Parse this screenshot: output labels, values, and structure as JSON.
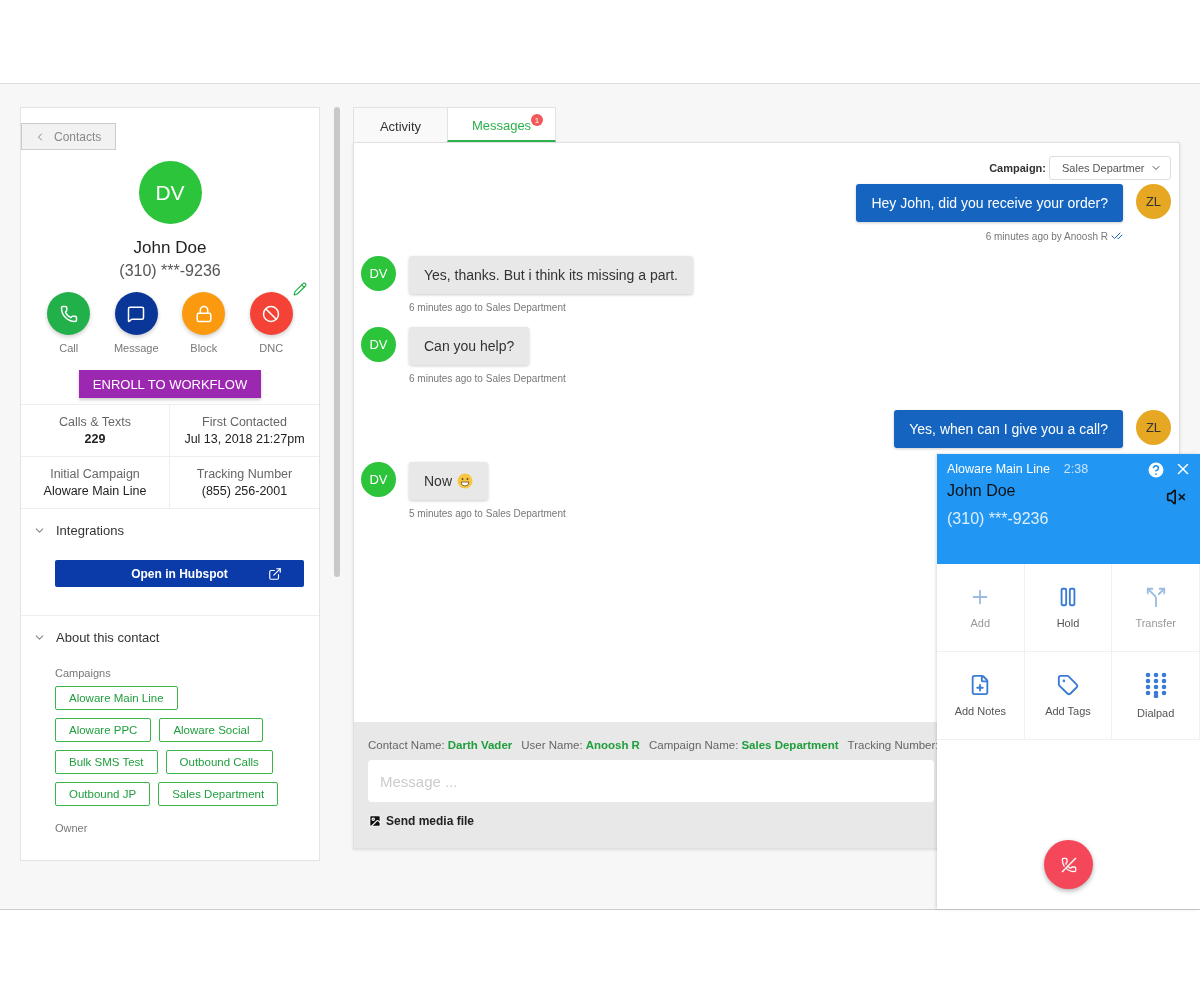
{
  "contact_panel": {
    "back_button": "Contacts",
    "avatar_initials": "DV",
    "name": "John Doe",
    "phone": "(310) ***-9236",
    "actions": [
      {
        "label": "Call",
        "kind": "call"
      },
      {
        "label": "Message",
        "kind": "message"
      },
      {
        "label": "Block",
        "kind": "block"
      },
      {
        "label": "DNC",
        "kind": "dnc"
      }
    ],
    "enroll_button": "ENROLL TO WORKFLOW",
    "stats": [
      {
        "label": "Calls & Texts",
        "value": "229"
      },
      {
        "label": "First Contacted",
        "value": "Jul 13, 2018 21:27pm"
      },
      {
        "label": "Initial Campaign",
        "value": "Aloware Main Line"
      },
      {
        "label": "Tracking Number",
        "value": "(855) 256-2001"
      }
    ],
    "integrations": {
      "title": "Integrations",
      "expanded": true,
      "button": "Open in Hubspot"
    },
    "about": {
      "title": "About this contact",
      "expanded": true,
      "campaigns_label": "Campaigns",
      "campaigns": [
        "Aloware Main Line",
        "Aloware PPC",
        "Aloware Social",
        "Bulk SMS Test",
        "Outbound Calls",
        "Outbound JP",
        "Sales Department"
      ],
      "owner_label": "Owner"
    }
  },
  "tabs": [
    {
      "label": "Activity",
      "selected": false
    },
    {
      "label": "Messages",
      "selected": true,
      "badge": "1"
    }
  ],
  "campaign_filter": {
    "label": "Campaign:",
    "value": "Sales Departmer"
  },
  "messages": [
    {
      "kind": "outbound",
      "initials": "ZL",
      "text": "Hey John, did you receive your order?",
      "meta": "6 minutes ago by Anoosh R",
      "read": true
    },
    {
      "kind": "inbound",
      "initials": "DV",
      "text": "Yes, thanks. But i think its missing a part.",
      "meta": "6 minutes ago to Sales Department"
    },
    {
      "kind": "inbound",
      "initials": "DV",
      "text": "Can you help?",
      "meta": "6 minutes ago to Sales Department"
    },
    {
      "kind": "outbound",
      "initials": "ZL",
      "text": "Yes, when can I give you a call?"
    },
    {
      "kind": "inbound",
      "initials": "DV",
      "text": "Now",
      "emoji": true,
      "meta": "5 minutes ago to Sales Department"
    }
  ],
  "composer": {
    "info": [
      {
        "label": "Contact Name:",
        "value": "Darth Vader"
      },
      {
        "label": "User Name:",
        "value": "Anoosh R"
      },
      {
        "label": "Campaign Name:",
        "value": "Sales Department"
      },
      {
        "label": "Tracking Number:"
      }
    ],
    "placeholder": "Message ...",
    "media_button": "Send media file"
  },
  "call_widget": {
    "line": "Aloware Main Line",
    "duration": "2:38",
    "name": "John Doe",
    "phone": "(310) ***-9236",
    "muted": true,
    "actions": [
      {
        "label": "Add",
        "kind": "add",
        "disabled": true
      },
      {
        "label": "Hold",
        "kind": "hold",
        "disabled": false
      },
      {
        "label": "Transfer",
        "kind": "transfer",
        "disabled": true
      },
      {
        "label": "Add Notes",
        "kind": "notes",
        "disabled": false
      },
      {
        "label": "Add Tags",
        "kind": "tags",
        "disabled": false
      },
      {
        "label": "Dialpad",
        "kind": "dialpad",
        "disabled": false
      }
    ]
  }
}
